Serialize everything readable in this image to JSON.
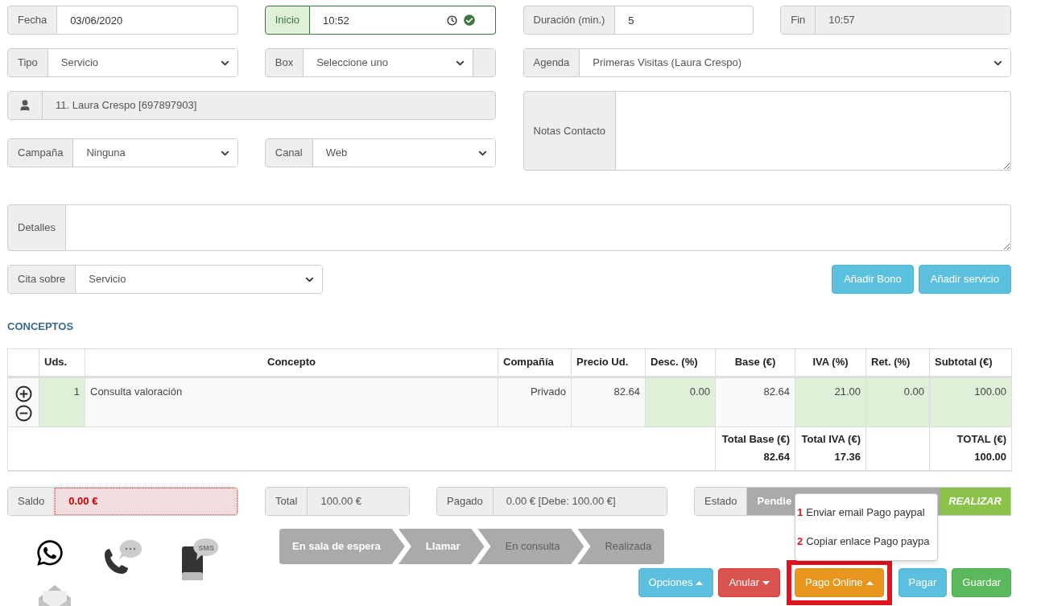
{
  "appointment": {
    "fecha": {
      "label": "Fecha",
      "value": "03/06/2020",
      "kind": "input"
    },
    "inicio": {
      "label": "Inicio",
      "value": "10:52",
      "kind": "input",
      "valid": true
    },
    "duracion": {
      "label": "Duración (min.)",
      "value": "5",
      "kind": "input"
    },
    "fin": {
      "label": "Fin",
      "value": "10:57",
      "kind": "readonly"
    },
    "tipo": {
      "label": "Tipo",
      "value": "Servicio",
      "kind": "select"
    },
    "box": {
      "label": "Box",
      "value": "Seleccione uno",
      "kind": "select",
      "addon_after": true
    },
    "agenda": {
      "label": "Agenda",
      "value": "Primeras Visitas (Laura Crespo)",
      "kind": "select"
    },
    "cliente": {
      "value": "11. Laura Crespo [697897903]",
      "kind": "readonly"
    },
    "notas_contacto": {
      "label": "Notas Contacto",
      "kind": "textarea"
    },
    "campana": {
      "label": "Campaña",
      "value": "Ninguna",
      "kind": "select"
    },
    "canal": {
      "label": "Canal",
      "value": "Web",
      "kind": "select"
    },
    "detalles": {
      "label": "Detalles",
      "kind": "textarea"
    },
    "cita_sobre": {
      "label": "Cita sobre",
      "value": "Servicio",
      "kind": "select"
    }
  },
  "add_buttons": [
    "Añadir Bono",
    "Añadir servicio"
  ],
  "conceptos": {
    "title": "CONCEPTOS",
    "columns": [
      "",
      "Uds.",
      "Concepto",
      "Compañía",
      "Precio Ud.",
      "Desc. (%)",
      "Base (€)",
      "IVA (%)",
      "Ret. (%)",
      "Subtotal (€)"
    ],
    "rows": [
      {
        "cells": [
          {
            "text": "",
            "editable": false
          },
          {
            "text": "1",
            "editable": true
          },
          {
            "text": "Consulta valoración",
            "editable": false
          },
          {
            "text": "Privado",
            "editable": false
          },
          {
            "text": "82.64",
            "editable": false
          },
          {
            "text": "0.00",
            "editable": true
          },
          {
            "text": "82.64",
            "editable": false
          },
          {
            "text": "21.00",
            "editable": true
          },
          {
            "text": "0.00",
            "editable": true
          },
          {
            "text": "100.00",
            "editable": true
          }
        ]
      }
    ],
    "totals": [
      {
        "kind": "total",
        "label": "Total Base (€)",
        "value": "82.64"
      },
      {
        "kind": "total",
        "label": "Total IVA (€)",
        "value": "17.36"
      },
      {
        "kind": "gap"
      },
      {
        "kind": "total",
        "label": "TOTAL (€)",
        "value": "100.00"
      }
    ]
  },
  "summary": {
    "saldo": {
      "label": "Saldo",
      "value": "0.00 €",
      "kind": "alert"
    },
    "total": {
      "label": "Total",
      "value": "100.00 €",
      "kind": "readonly"
    },
    "pagado": {
      "label": "Pagado",
      "value": "0.00 € [Debe: 100.00 €]",
      "kind": "readonly"
    },
    "estado": {
      "label": "Estado",
      "value": "Pendie",
      "action": "REALIZAR"
    }
  },
  "sms_badge": "SMS",
  "steps": [
    {
      "label": "En sala de espera",
      "done": true
    },
    {
      "label": "Llamar",
      "done": true
    },
    {
      "label": "En consulta",
      "done": false
    },
    {
      "label": "Realizada",
      "done": false
    }
  ],
  "actions": [
    {
      "label": "Opciones",
      "kind": "dropup",
      "highlighted": false
    },
    {
      "label": "Anular",
      "kind": "dropdown",
      "highlighted": false
    },
    {
      "label": "Pago Online",
      "kind": "dropup",
      "highlighted": true
    },
    {
      "label": "Pagar",
      "kind": "plain",
      "highlighted": false
    },
    {
      "label": "Guardar",
      "kind": "plain",
      "highlighted": false
    }
  ],
  "menu": {
    "items": [
      {
        "marker": "1",
        "label": "Enviar email Pago paypal"
      },
      {
        "marker": "2",
        "label": "Copiar enlace Pago paypa"
      }
    ]
  }
}
